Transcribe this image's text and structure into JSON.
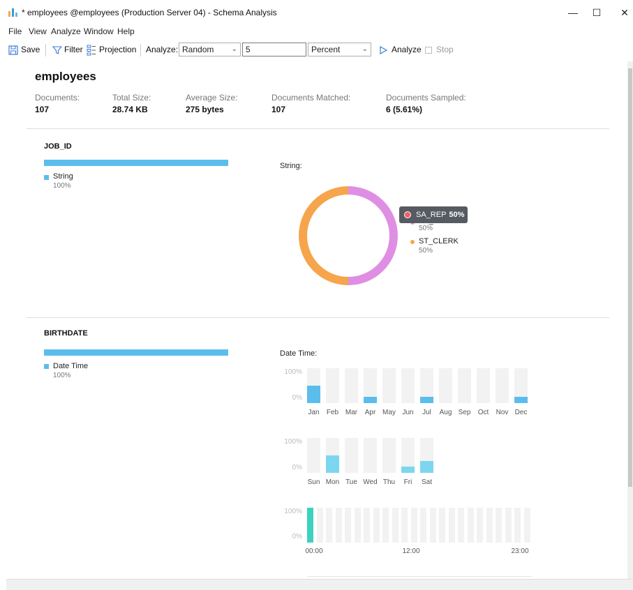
{
  "window": {
    "title": "* employees @employees (Production Server 04) - Schema Analysis",
    "minimize": "—",
    "maximize": "☐",
    "close": "✕"
  },
  "menu": [
    "File",
    "View",
    "Analyze",
    "Window",
    "Help"
  ],
  "toolbar": {
    "save": "Save",
    "filter": "Filter",
    "projection": "Projection",
    "analyze_label": "Analyze:",
    "mode_value": "Random",
    "count_value": "5",
    "unit_value": "Percent",
    "analyze_button": "Analyze",
    "stop_button": "Stop"
  },
  "collection": {
    "name": "employees",
    "stats": [
      {
        "label": "Documents:",
        "value": "107"
      },
      {
        "label": "Total Size:",
        "value": "28.74 KB"
      },
      {
        "label": "Average Size:",
        "value": "275 bytes"
      },
      {
        "label": "Documents Matched:",
        "value": "107"
      },
      {
        "label": "Documents Sampled:",
        "value": "6 (5.61%)"
      }
    ]
  },
  "fields": [
    {
      "name": "JOB_ID",
      "type_label": "String",
      "type_pct": "100%",
      "type_fraction": 1.0,
      "chart_title": "String:",
      "tooltip": {
        "label": "SA_REP",
        "value": "50%"
      },
      "legend": [
        {
          "name": "SA_REP",
          "pct": "50%"
        },
        {
          "name": "ST_CLERK",
          "pct": "50%"
        }
      ]
    },
    {
      "name": "BIRTHDATE",
      "type_label": "Date Time",
      "type_pct": "100%",
      "type_fraction": 1.0,
      "chart_title": "Date Time:"
    }
  ],
  "axis": {
    "top": "100%",
    "bottom": "0%"
  },
  "hour_labels": [
    "00:00",
    "12:00",
    "23:00"
  ],
  "colors": {
    "sa_rep": "#df8fe3",
    "st_clerk": "#f6a54c",
    "bar_blue": "#5bbdec",
    "bar_light": "#7dd6ef",
    "bar_teal": "#3dd1c0"
  },
  "chart_data": [
    {
      "type": "pie",
      "title": "String:",
      "categories": [
        "SA_REP",
        "ST_CLERK"
      ],
      "values": [
        50,
        50
      ]
    },
    {
      "type": "bar",
      "categories": [
        "Jan",
        "Feb",
        "Mar",
        "Apr",
        "May",
        "Jun",
        "Jul",
        "Aug",
        "Sep",
        "Oct",
        "Nov",
        "Dec"
      ],
      "values": [
        50,
        0,
        0,
        17,
        0,
        0,
        17,
        0,
        0,
        0,
        0,
        17
      ],
      "ylim": [
        0,
        100
      ]
    },
    {
      "type": "bar",
      "categories": [
        "Sun",
        "Mon",
        "Tue",
        "Wed",
        "Thu",
        "Fri",
        "Sat"
      ],
      "values": [
        0,
        50,
        0,
        0,
        0,
        17,
        33
      ],
      "ylim": [
        0,
        100
      ]
    },
    {
      "type": "bar",
      "categories": [
        "00",
        "01",
        "02",
        "03",
        "04",
        "05",
        "06",
        "07",
        "08",
        "09",
        "10",
        "11",
        "12",
        "13",
        "14",
        "15",
        "16",
        "17",
        "18",
        "19",
        "20",
        "21",
        "22",
        "23"
      ],
      "values": [
        100,
        0,
        0,
        0,
        0,
        0,
        0,
        0,
        0,
        0,
        0,
        0,
        0,
        0,
        0,
        0,
        0,
        0,
        0,
        0,
        0,
        0,
        0,
        0
      ],
      "ylim": [
        0,
        100
      ]
    }
  ]
}
